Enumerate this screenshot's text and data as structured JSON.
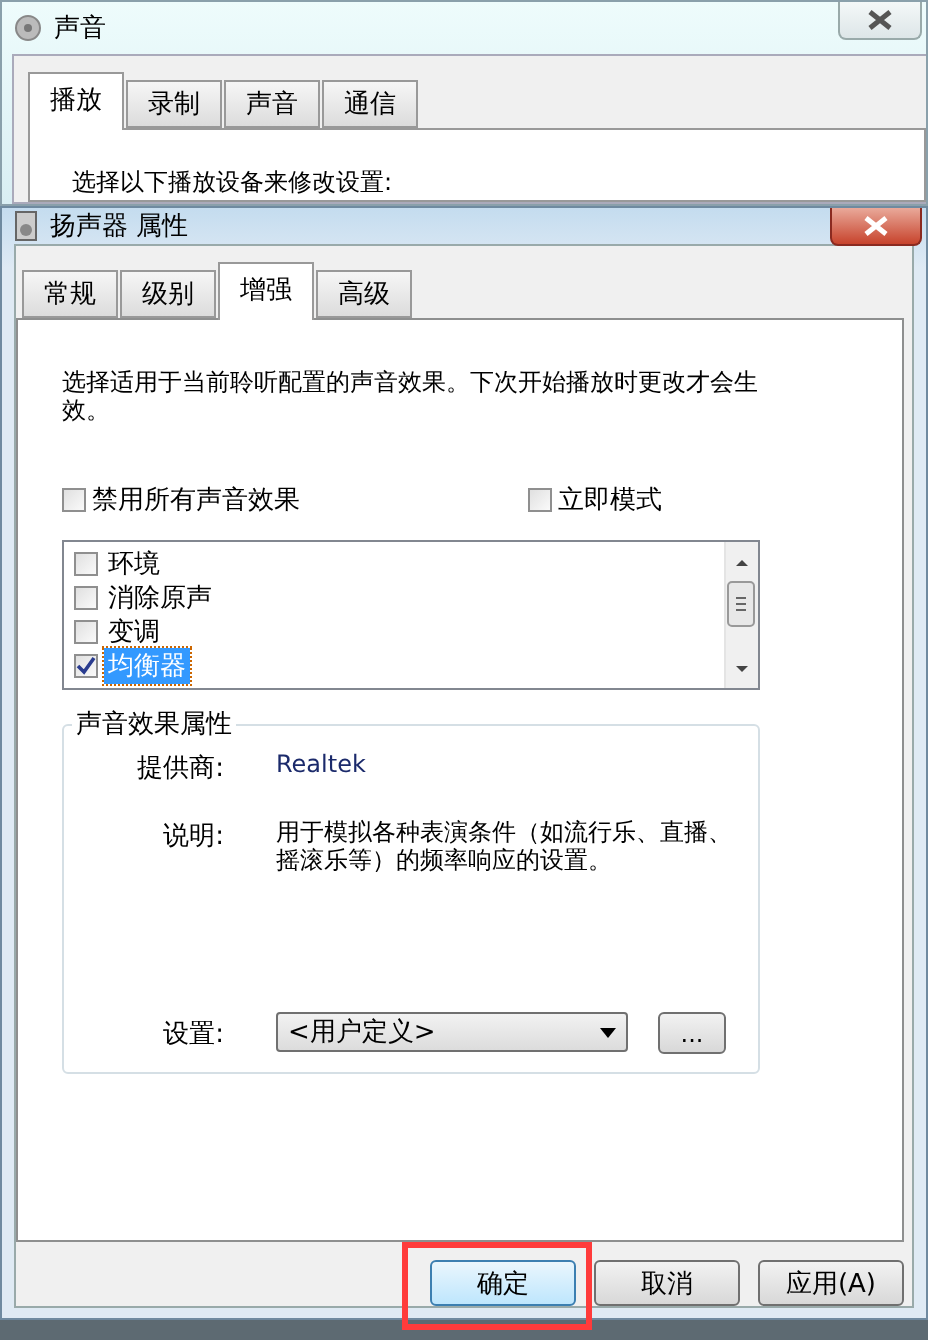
{
  "back_window": {
    "title": "声音",
    "tabs": [
      {
        "label": "播放",
        "selected": true
      },
      {
        "label": "录制",
        "selected": false
      },
      {
        "label": "声音",
        "selected": false
      },
      {
        "label": "通信",
        "selected": false
      }
    ],
    "prompt": "选择以下播放设备来修改设置:"
  },
  "dialog": {
    "title": "扬声器 属性",
    "tabs": [
      {
        "label": "常规",
        "selected": false
      },
      {
        "label": "级别",
        "selected": false
      },
      {
        "label": "增强",
        "selected": true
      },
      {
        "label": "高级",
        "selected": false
      }
    ],
    "intro": "选择适用于当前聆听配置的声音效果。下次开始播放时更改才会生效。",
    "options": [
      {
        "label": "禁用所有声音效果",
        "checked": false
      },
      {
        "label": "立即模式",
        "checked": false
      }
    ],
    "effects": [
      {
        "label": "环境",
        "checked": false,
        "selected": false
      },
      {
        "label": "消除原声",
        "checked": false,
        "selected": false
      },
      {
        "label": "变调",
        "checked": false,
        "selected": false
      },
      {
        "label": "均衡器",
        "checked": true,
        "selected": true
      }
    ],
    "properties": {
      "title": "声音效果属性",
      "provider_label": "提供商:",
      "provider": "Realtek",
      "description_label": "说明:",
      "description": "用于模拟各种表演条件（如流行乐、直播、摇滚乐等）的频率响应的设置。",
      "setting_label": "设置:",
      "setting_value": "<用户定义>",
      "more_button": "..."
    },
    "buttons": [
      {
        "label": "确定",
        "default": true,
        "highlighted": true
      },
      {
        "label": "取消",
        "default": false,
        "highlighted": false
      },
      {
        "label": "应用(A)",
        "default": false,
        "highlighted": false
      }
    ]
  }
}
